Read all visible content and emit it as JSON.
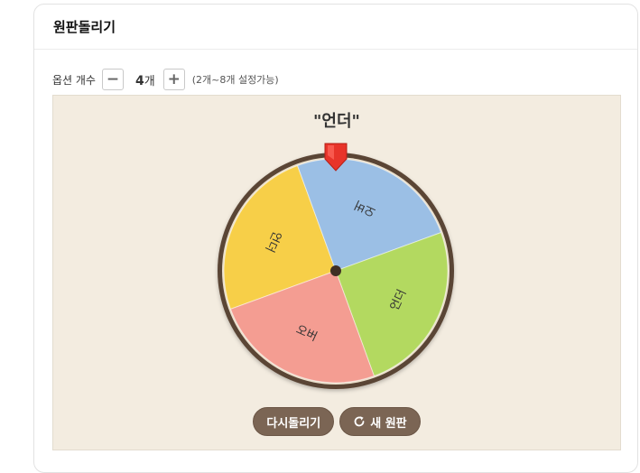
{
  "header": {
    "title": "원판돌리기"
  },
  "options": {
    "label": "옵션 개수",
    "minus": "−",
    "plus": "+",
    "count": "4",
    "count_unit": "개",
    "hint": "(2개~8개 설정가능)"
  },
  "result": {
    "text": "\"언더\""
  },
  "wheel": {
    "segments": [
      {
        "label": "언더",
        "color": "#f7cf48"
      },
      {
        "label": "오버",
        "color": "#9bbfe5"
      },
      {
        "label": "언더",
        "color": "#b3d960"
      },
      {
        "label": "오버",
        "color": "#f49d92"
      }
    ],
    "rim_color": "#5a4535",
    "pointer_color": "#e8342a"
  },
  "buttons": {
    "respin": "다시돌리기",
    "new_wheel": "새 원판"
  }
}
